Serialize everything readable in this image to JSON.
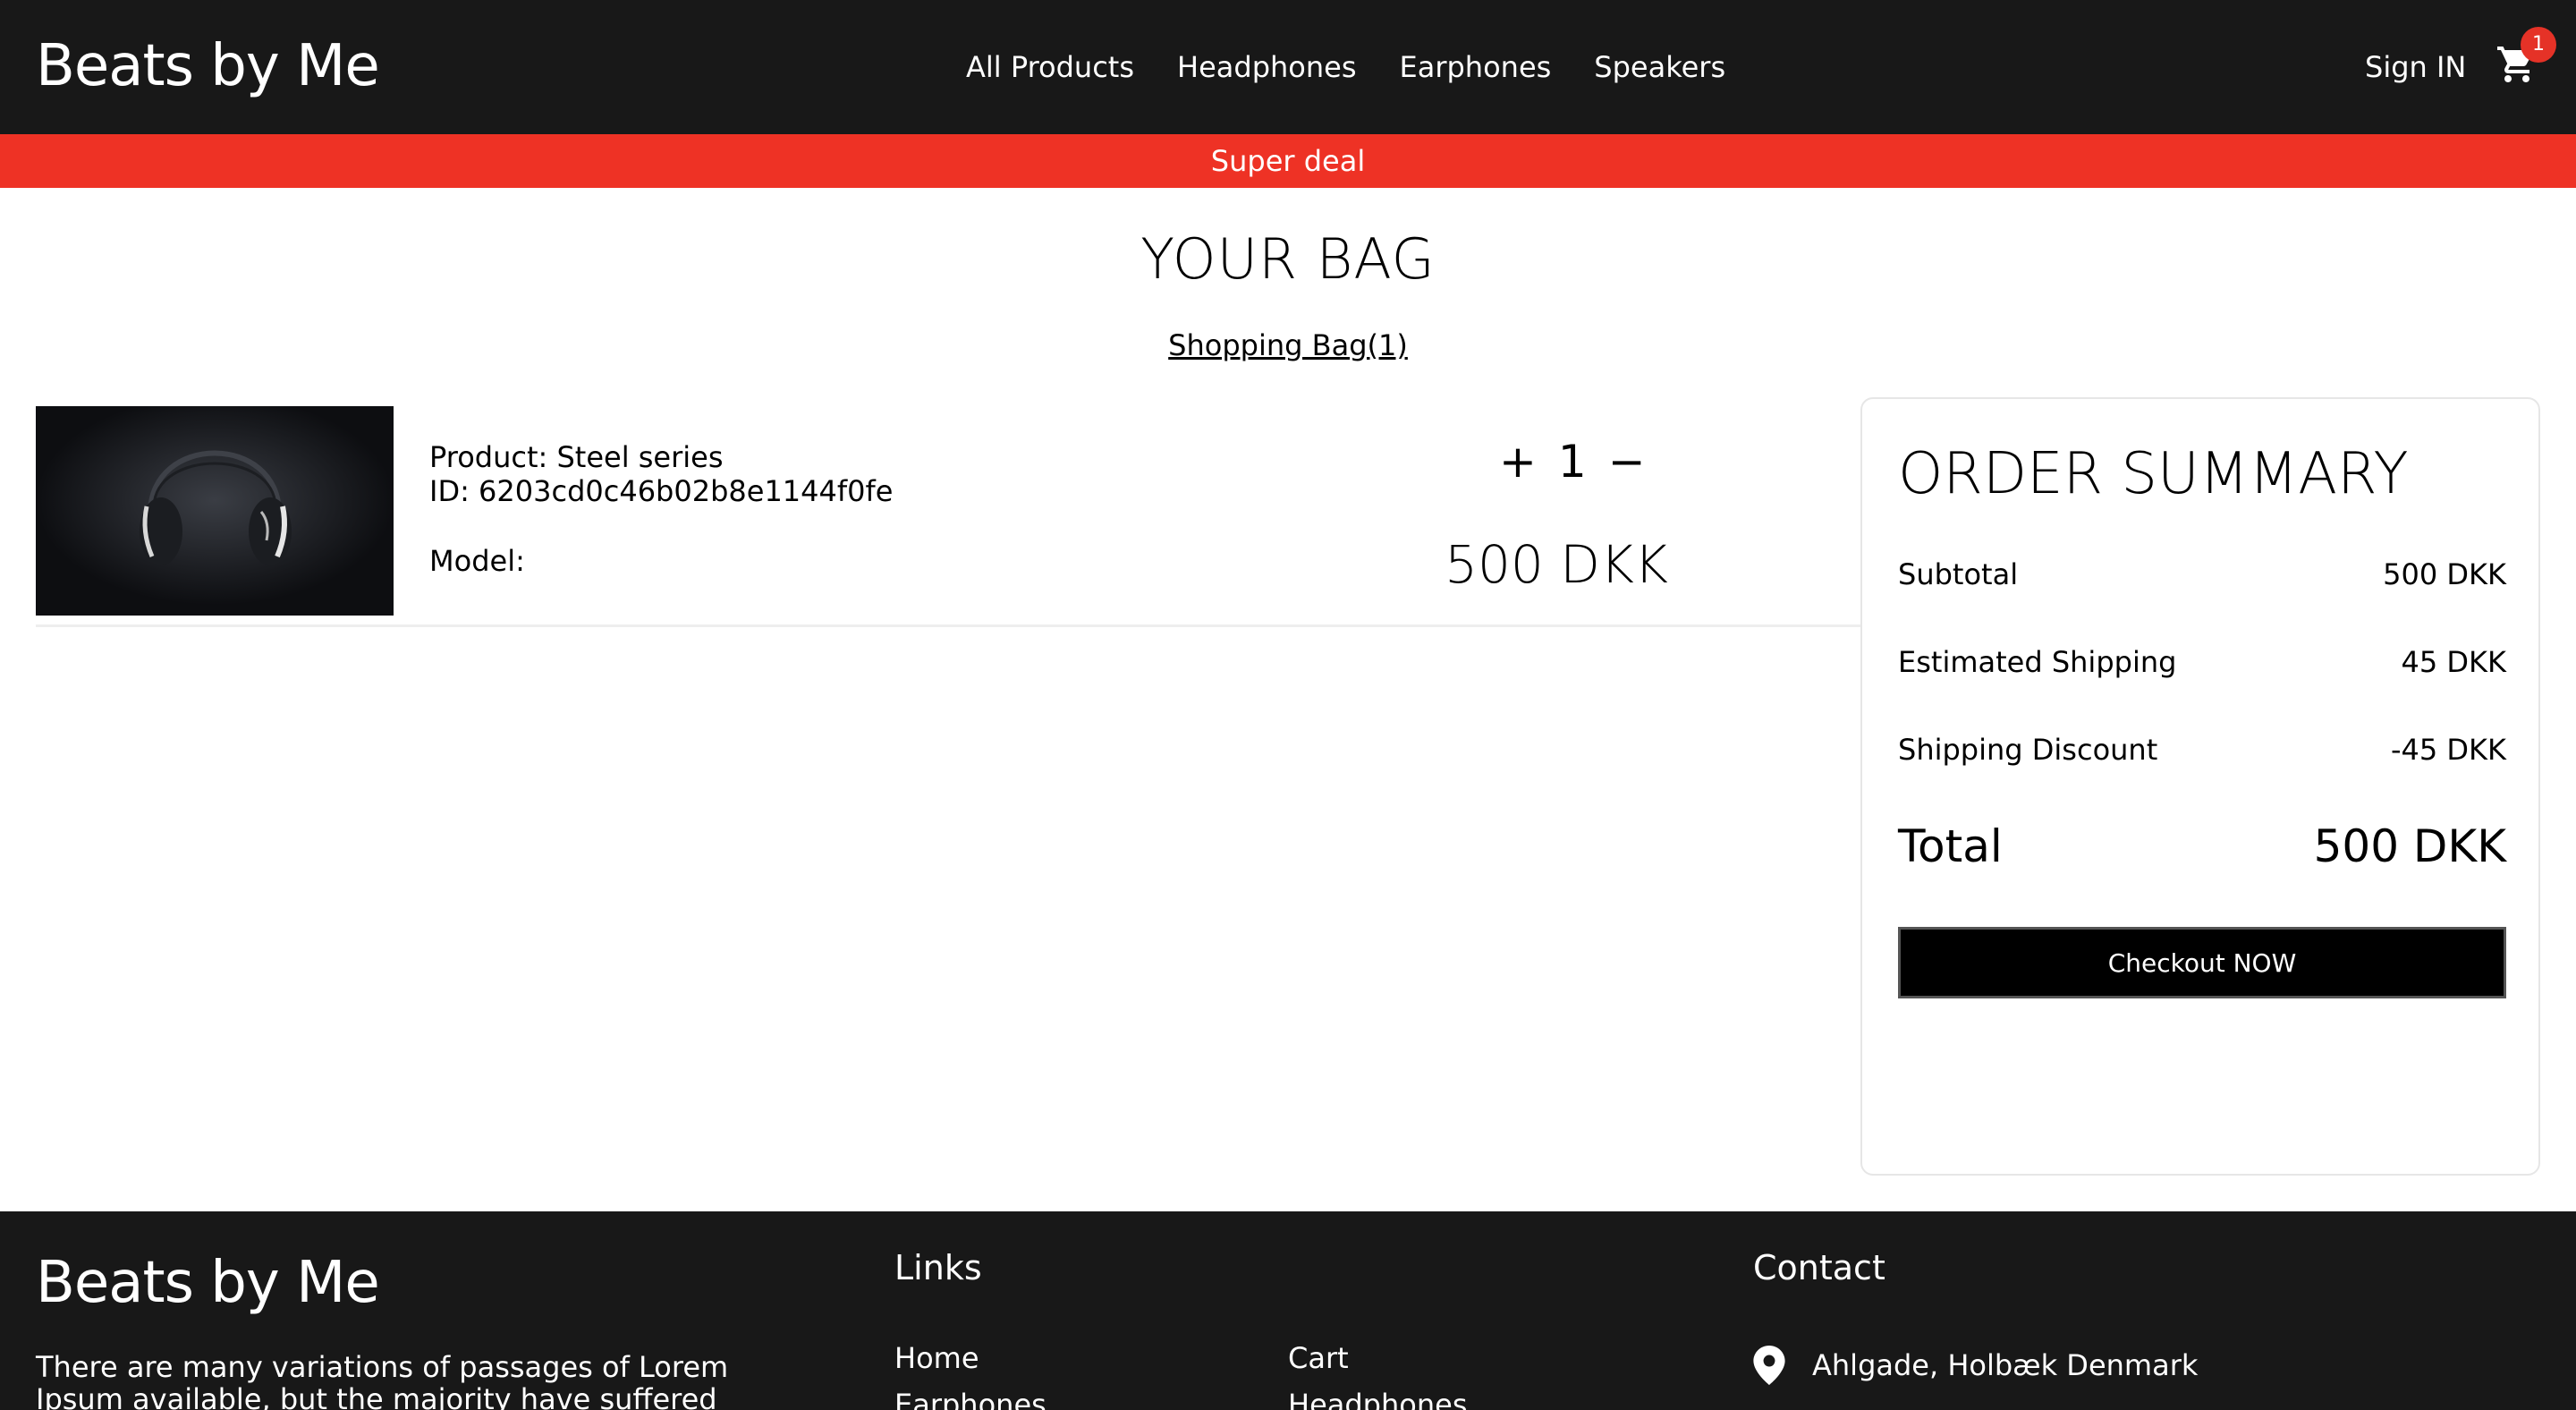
{
  "header": {
    "logo": "Beats by Me",
    "nav": [
      "All Products",
      "Headphones",
      "Earphones",
      "Speakers"
    ],
    "sign_in": "Sign IN",
    "cart_icon": "cart-icon",
    "cart_count": "1"
  },
  "banner": {
    "text": "Super deal"
  },
  "bag": {
    "title": "YOUR BAG",
    "tab": "Shopping Bag(1)"
  },
  "item": {
    "product": "Product: Steel series",
    "id": "ID: 6203cd0c46b02b8e1144f0fe",
    "model": "Model:",
    "plus": "+",
    "quantity": "1",
    "minus": "−",
    "price": "500 DKK"
  },
  "summary": {
    "title": "ORDER SUMMARY",
    "rows": [
      {
        "label": "Subtotal",
        "value": "500 DKK"
      },
      {
        "label": "Estimated Shipping",
        "value": "45 DKK"
      },
      {
        "label": "Shipping Discount",
        "value": "-45 DKK"
      }
    ],
    "total_label": "Total",
    "total_value": "500 DKK",
    "checkout": "Checkout NOW"
  },
  "footer": {
    "logo": "Beats by Me",
    "description": "There are many variations of passages of Lorem Ipsum available, but the majority have suffered alteration in some",
    "links_heading": "Links",
    "links_col1": [
      "Home",
      "Earphones"
    ],
    "links_col2": [
      "Cart",
      "Headphones"
    ],
    "contact_heading": "Contact",
    "address": "Ahlgade, Holbæk Denmark",
    "address_icon": "location-pin-icon"
  },
  "colors": {
    "header_bg": "#181818",
    "banner_bg": "#ee3225",
    "badge_bg": "#e53227",
    "button_bg": "#000000"
  }
}
